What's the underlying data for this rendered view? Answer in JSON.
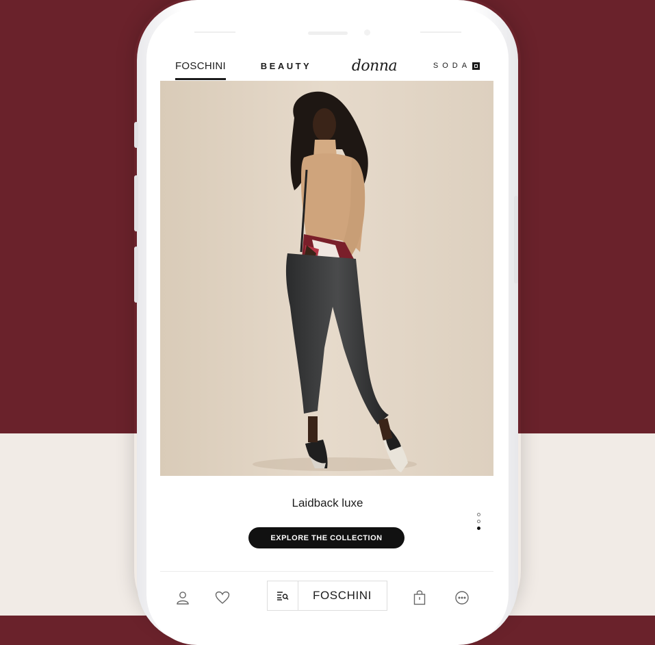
{
  "brand_tabs": [
    {
      "label": "FOSCHINI",
      "active": true
    },
    {
      "label": "BEAUTY"
    },
    {
      "label": "donna"
    },
    {
      "label": "SODA"
    }
  ],
  "hero": {
    "caption": "Laidback luxe",
    "cta_label": "EXPLORE THE COLLECTION",
    "carousel_dots": 3,
    "active_dot": 3
  },
  "bottom_nav": {
    "brand_selector_label": "FOSCHINI",
    "icons": [
      "account-icon",
      "wishlist-heart-icon",
      "search-menu-icon",
      "shopping-bag-icon",
      "more-options-icon"
    ]
  },
  "colors": {
    "background_top": "#6a222b",
    "background_bottom": "#f1ebe6",
    "accent": "#111111"
  }
}
